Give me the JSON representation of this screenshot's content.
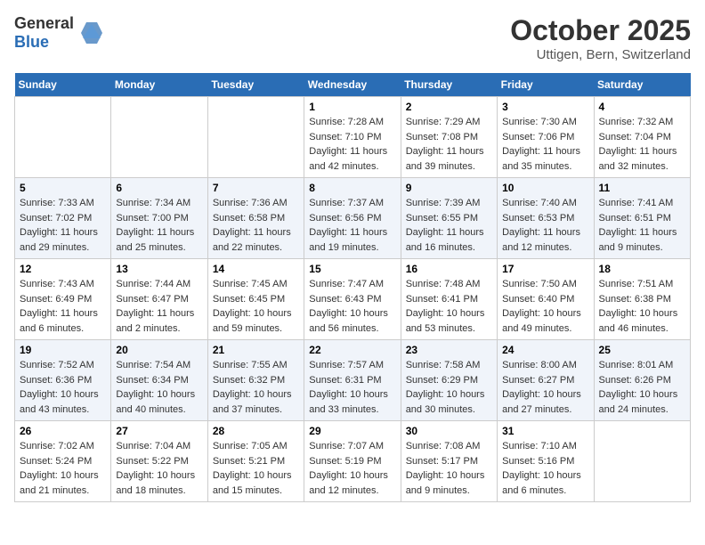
{
  "header": {
    "logo_general": "General",
    "logo_blue": "Blue",
    "month": "October 2025",
    "location": "Uttigen, Bern, Switzerland"
  },
  "days_of_week": [
    "Sunday",
    "Monday",
    "Tuesday",
    "Wednesday",
    "Thursday",
    "Friday",
    "Saturday"
  ],
  "weeks": [
    [
      {
        "day": "",
        "sunrise": "",
        "sunset": "",
        "daylight": ""
      },
      {
        "day": "",
        "sunrise": "",
        "sunset": "",
        "daylight": ""
      },
      {
        "day": "",
        "sunrise": "",
        "sunset": "",
        "daylight": ""
      },
      {
        "day": "1",
        "sunrise": "Sunrise: 7:28 AM",
        "sunset": "Sunset: 7:10 PM",
        "daylight": "Daylight: 11 hours and 42 minutes."
      },
      {
        "day": "2",
        "sunrise": "Sunrise: 7:29 AM",
        "sunset": "Sunset: 7:08 PM",
        "daylight": "Daylight: 11 hours and 39 minutes."
      },
      {
        "day": "3",
        "sunrise": "Sunrise: 7:30 AM",
        "sunset": "Sunset: 7:06 PM",
        "daylight": "Daylight: 11 hours and 35 minutes."
      },
      {
        "day": "4",
        "sunrise": "Sunrise: 7:32 AM",
        "sunset": "Sunset: 7:04 PM",
        "daylight": "Daylight: 11 hours and 32 minutes."
      }
    ],
    [
      {
        "day": "5",
        "sunrise": "Sunrise: 7:33 AM",
        "sunset": "Sunset: 7:02 PM",
        "daylight": "Daylight: 11 hours and 29 minutes."
      },
      {
        "day": "6",
        "sunrise": "Sunrise: 7:34 AM",
        "sunset": "Sunset: 7:00 PM",
        "daylight": "Daylight: 11 hours and 25 minutes."
      },
      {
        "day": "7",
        "sunrise": "Sunrise: 7:36 AM",
        "sunset": "Sunset: 6:58 PM",
        "daylight": "Daylight: 11 hours and 22 minutes."
      },
      {
        "day": "8",
        "sunrise": "Sunrise: 7:37 AM",
        "sunset": "Sunset: 6:56 PM",
        "daylight": "Daylight: 11 hours and 19 minutes."
      },
      {
        "day": "9",
        "sunrise": "Sunrise: 7:39 AM",
        "sunset": "Sunset: 6:55 PM",
        "daylight": "Daylight: 11 hours and 16 minutes."
      },
      {
        "day": "10",
        "sunrise": "Sunrise: 7:40 AM",
        "sunset": "Sunset: 6:53 PM",
        "daylight": "Daylight: 11 hours and 12 minutes."
      },
      {
        "day": "11",
        "sunrise": "Sunrise: 7:41 AM",
        "sunset": "Sunset: 6:51 PM",
        "daylight": "Daylight: 11 hours and 9 minutes."
      }
    ],
    [
      {
        "day": "12",
        "sunrise": "Sunrise: 7:43 AM",
        "sunset": "Sunset: 6:49 PM",
        "daylight": "Daylight: 11 hours and 6 minutes."
      },
      {
        "day": "13",
        "sunrise": "Sunrise: 7:44 AM",
        "sunset": "Sunset: 6:47 PM",
        "daylight": "Daylight: 11 hours and 2 minutes."
      },
      {
        "day": "14",
        "sunrise": "Sunrise: 7:45 AM",
        "sunset": "Sunset: 6:45 PM",
        "daylight": "Daylight: 10 hours and 59 minutes."
      },
      {
        "day": "15",
        "sunrise": "Sunrise: 7:47 AM",
        "sunset": "Sunset: 6:43 PM",
        "daylight": "Daylight: 10 hours and 56 minutes."
      },
      {
        "day": "16",
        "sunrise": "Sunrise: 7:48 AM",
        "sunset": "Sunset: 6:41 PM",
        "daylight": "Daylight: 10 hours and 53 minutes."
      },
      {
        "day": "17",
        "sunrise": "Sunrise: 7:50 AM",
        "sunset": "Sunset: 6:40 PM",
        "daylight": "Daylight: 10 hours and 49 minutes."
      },
      {
        "day": "18",
        "sunrise": "Sunrise: 7:51 AM",
        "sunset": "Sunset: 6:38 PM",
        "daylight": "Daylight: 10 hours and 46 minutes."
      }
    ],
    [
      {
        "day": "19",
        "sunrise": "Sunrise: 7:52 AM",
        "sunset": "Sunset: 6:36 PM",
        "daylight": "Daylight: 10 hours and 43 minutes."
      },
      {
        "day": "20",
        "sunrise": "Sunrise: 7:54 AM",
        "sunset": "Sunset: 6:34 PM",
        "daylight": "Daylight: 10 hours and 40 minutes."
      },
      {
        "day": "21",
        "sunrise": "Sunrise: 7:55 AM",
        "sunset": "Sunset: 6:32 PM",
        "daylight": "Daylight: 10 hours and 37 minutes."
      },
      {
        "day": "22",
        "sunrise": "Sunrise: 7:57 AM",
        "sunset": "Sunset: 6:31 PM",
        "daylight": "Daylight: 10 hours and 33 minutes."
      },
      {
        "day": "23",
        "sunrise": "Sunrise: 7:58 AM",
        "sunset": "Sunset: 6:29 PM",
        "daylight": "Daylight: 10 hours and 30 minutes."
      },
      {
        "day": "24",
        "sunrise": "Sunrise: 8:00 AM",
        "sunset": "Sunset: 6:27 PM",
        "daylight": "Daylight: 10 hours and 27 minutes."
      },
      {
        "day": "25",
        "sunrise": "Sunrise: 8:01 AM",
        "sunset": "Sunset: 6:26 PM",
        "daylight": "Daylight: 10 hours and 24 minutes."
      }
    ],
    [
      {
        "day": "26",
        "sunrise": "Sunrise: 7:02 AM",
        "sunset": "Sunset: 5:24 PM",
        "daylight": "Daylight: 10 hours and 21 minutes."
      },
      {
        "day": "27",
        "sunrise": "Sunrise: 7:04 AM",
        "sunset": "Sunset: 5:22 PM",
        "daylight": "Daylight: 10 hours and 18 minutes."
      },
      {
        "day": "28",
        "sunrise": "Sunrise: 7:05 AM",
        "sunset": "Sunset: 5:21 PM",
        "daylight": "Daylight: 10 hours and 15 minutes."
      },
      {
        "day": "29",
        "sunrise": "Sunrise: 7:07 AM",
        "sunset": "Sunset: 5:19 PM",
        "daylight": "Daylight: 10 hours and 12 minutes."
      },
      {
        "day": "30",
        "sunrise": "Sunrise: 7:08 AM",
        "sunset": "Sunset: 5:17 PM",
        "daylight": "Daylight: 10 hours and 9 minutes."
      },
      {
        "day": "31",
        "sunrise": "Sunrise: 7:10 AM",
        "sunset": "Sunset: 5:16 PM",
        "daylight": "Daylight: 10 hours and 6 minutes."
      },
      {
        "day": "",
        "sunrise": "",
        "sunset": "",
        "daylight": ""
      }
    ]
  ]
}
